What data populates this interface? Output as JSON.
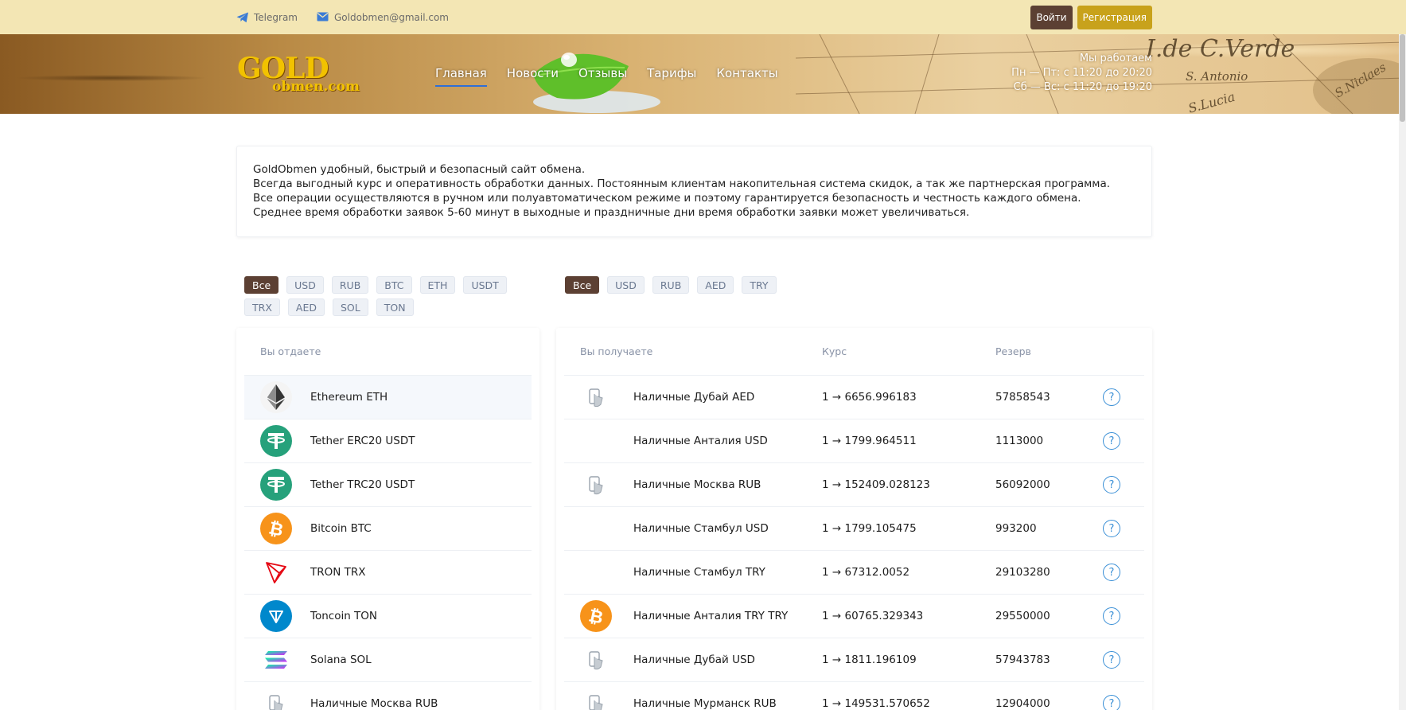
{
  "topbar": {
    "telegram_label": "Telegram",
    "email_label": "Goldobmen@gmail.com",
    "login_label": "Войти",
    "register_label": "Регистрация"
  },
  "header": {
    "logo_main": "GOLD",
    "logo_sub": "obmen.com",
    "nav": [
      "Главная",
      "Новости",
      "Отзывы",
      "Тарифы",
      "Контакты"
    ],
    "hours_title": "Мы работаем",
    "hours_weekdays": "Пн — Пт: с 11:20 до 20:20",
    "hours_weekend": "Сб — Вс: с 11:20 до 19:20"
  },
  "info": {
    "lines": [
      "GoldObmen удобный, быстрый и безопасный сайт обмена.",
      "Всегда выгодный курс и оперативность обработки данных. Постоянным клиентам накопительная система скидок, а так же партнерская программа.",
      "Все операции осуществляются в ручном или полуавтоматическом режиме и поэтому гарантируется безопасность и честность каждого обмена.",
      "Среднее время обработки заявок 5-60 минут в выходные и праздничные дни время обработки заявки может увеличиваться."
    ]
  },
  "give_filters": [
    "Все",
    "USD",
    "RUB",
    "BTC",
    "ETH",
    "USDT",
    "TRX",
    "AED",
    "SOL",
    "TON"
  ],
  "get_filters": [
    "Все",
    "USD",
    "RUB",
    "AED",
    "TRY"
  ],
  "give": {
    "header": "Вы отдаете",
    "items": [
      {
        "name": "Ethereum ETH",
        "icon": "ethereum-icon"
      },
      {
        "name": "Tether ERC20 USDT",
        "icon": "tether-icon"
      },
      {
        "name": "Tether TRC20 USDT",
        "icon": "tether-icon"
      },
      {
        "name": "Bitcoin BTC",
        "icon": "bitcoin-icon"
      },
      {
        "name": "TRON TRX",
        "icon": "tron-icon"
      },
      {
        "name": "Toncoin TON",
        "icon": "toncoin-icon"
      },
      {
        "name": "Solana SOL",
        "icon": "solana-icon"
      },
      {
        "name": "Наличные Москва RUB",
        "icon": "cash-icon"
      }
    ]
  },
  "get": {
    "header_name": "Вы получаете",
    "header_rate": "Курс",
    "header_reserve": "Резерв",
    "items": [
      {
        "name": "Наличные Дубай AED",
        "rate": "1 → 6656.996183",
        "reserve": "57858543",
        "icon": "cash-icon"
      },
      {
        "name": "Наличные Анталия USD",
        "rate": "1 → 1799.964511",
        "reserve": "1113000",
        "icon": ""
      },
      {
        "name": "Наличные Москва RUB",
        "rate": "1 → 152409.028123",
        "reserve": "56092000",
        "icon": "cash-icon"
      },
      {
        "name": "Наличные Стамбул USD",
        "rate": "1 → 1799.105475",
        "reserve": "993200",
        "icon": ""
      },
      {
        "name": "Наличные Стамбул TRY",
        "rate": "1 → 67312.0052",
        "reserve": "29103280",
        "icon": ""
      },
      {
        "name": "Наличные Анталия TRY TRY",
        "rate": "1 → 60765.329343",
        "reserve": "29550000",
        "icon": "bitcoin-icon"
      },
      {
        "name": "Наличные Дубай USD",
        "rate": "1 → 1811.196109",
        "reserve": "57943783",
        "icon": "cash-icon"
      },
      {
        "name": "Наличные Мурманск RUB",
        "rate": "1 → 149531.570652",
        "reserve": "12904000",
        "icon": "cash-icon"
      }
    ]
  },
  "colors": {
    "topbar_bg": "#f3e6b4",
    "brown": "#5c4033",
    "gold": "#c8a21b",
    "tether": "#26a17b",
    "bitcoin": "#f7931a",
    "ton": "#0088cc",
    "tron": "#e50914",
    "link_blue": "#3a8fd6"
  }
}
